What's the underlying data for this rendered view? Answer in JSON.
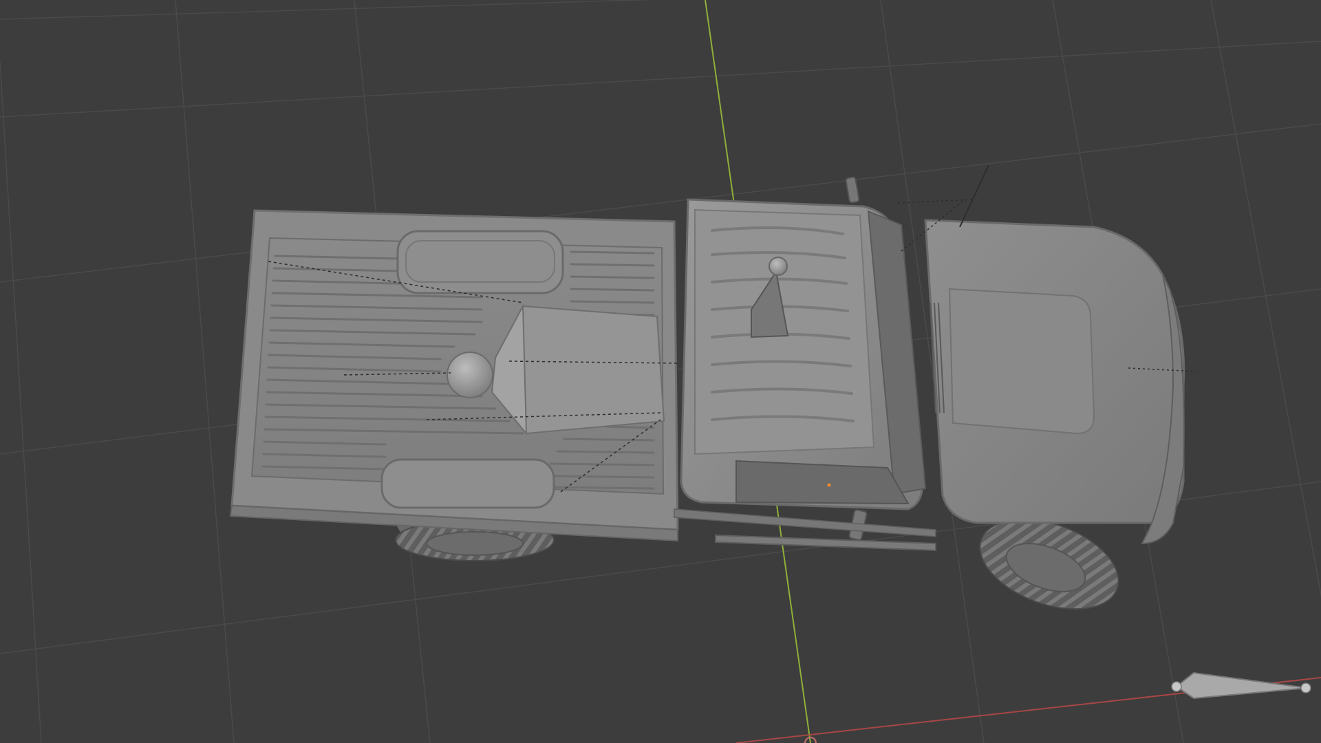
{
  "viewport": {
    "kind": "3d-viewport",
    "shading": "solid",
    "background_color": "#3d3d3d",
    "grid_color": "#4c4c4c",
    "y_axis_color": "#8fb03a",
    "x_axis_color": "#b04a4a",
    "object_color": "#8c8c8c"
  },
  "objects": [
    {
      "name": "pickup-truck-mesh",
      "type": "mesh"
    },
    {
      "name": "spot-light",
      "type": "light"
    },
    {
      "name": "camera",
      "type": "camera"
    },
    {
      "name": "sun-light",
      "type": "light"
    }
  ]
}
